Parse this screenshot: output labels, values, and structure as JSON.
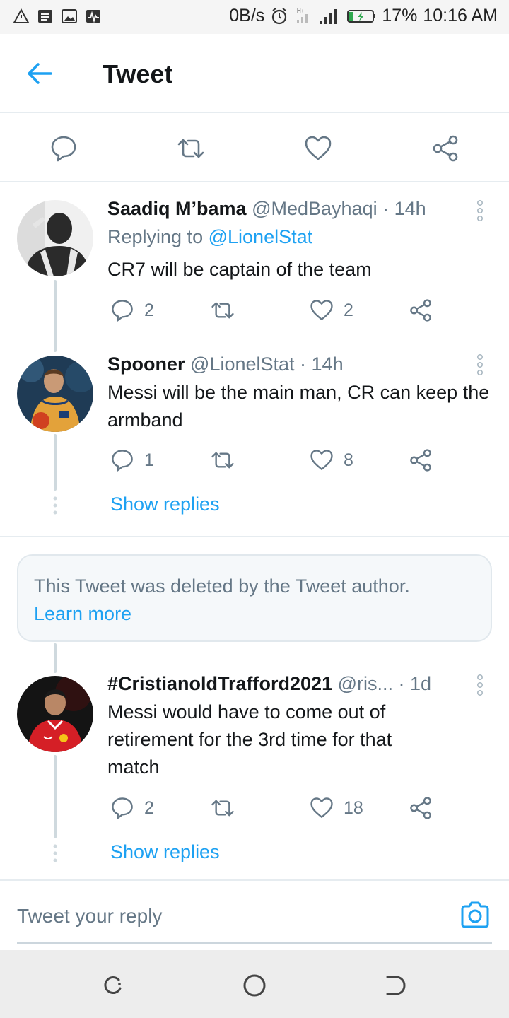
{
  "status_bar": {
    "net_speed": "0B/s",
    "battery": "17%",
    "time": "10:16 AM"
  },
  "header": {
    "title": "Tweet"
  },
  "tweets": [
    {
      "name": "Saadiq M’bama",
      "handle": "@MedBayhaqi",
      "time": "· 14h",
      "replying_label": "Replying to",
      "replying_to": "@LionelStat",
      "text": "CR7 will be captain of the team",
      "replies": "2",
      "retweets": "",
      "likes": "2"
    },
    {
      "name": "Spooner",
      "handle": "@LionelStat",
      "time": "· 14h",
      "text": "Messi will be the main man, CR can keep the armband",
      "replies": "1",
      "retweets": "",
      "likes": "8",
      "show_replies": "Show replies"
    },
    {
      "name": "#CristianoldTrafford2021",
      "handle": "@ris...",
      "time": "· 1d",
      "text": "Messi would have to come out of retirement for the 3rd time for that match",
      "replies": "2",
      "retweets": "",
      "likes": "18",
      "show_replies": "Show replies"
    }
  ],
  "deleted_notice": {
    "text": "This Tweet was deleted by the Tweet author.",
    "link": "Learn more"
  },
  "reply_bar": {
    "placeholder": "Tweet your reply"
  },
  "colors": {
    "accent": "#1da1f2",
    "secondary_text": "#657786",
    "divider": "#e6ecf0"
  }
}
